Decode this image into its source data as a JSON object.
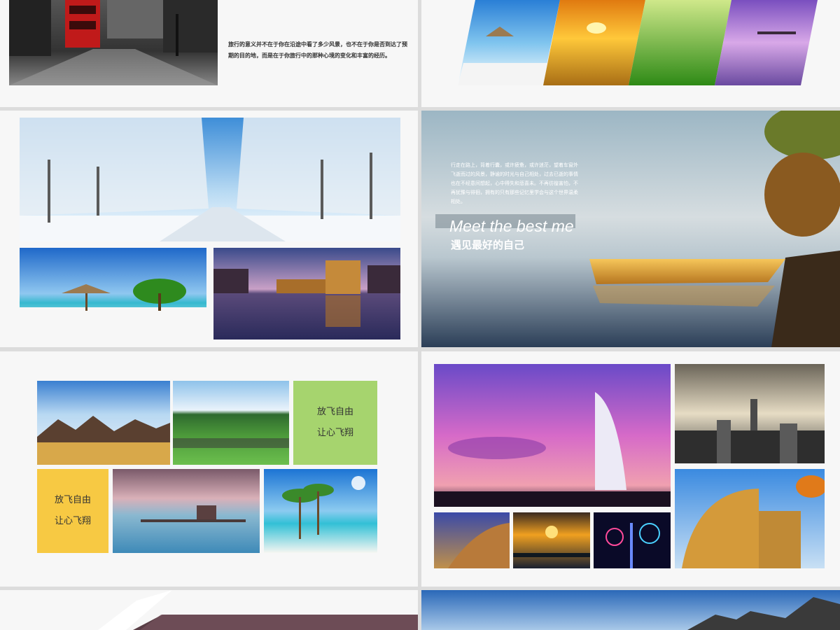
{
  "slides": {
    "travel_quote": {
      "text": "旅行的意义并不在于你在沿途中看了多少风景，也不在于你是否到达了预期的目的地，而是在于你旅行中的那种心境的变化和丰富的经历。"
    },
    "meet": {
      "paragraph": "行走在路上，背着行囊，或许疲惫，或许迷茫，望着车窗外飞逝而过的风景，静谧的时光与自己相处，过去已逝的事情也在不经意间想起，心中得失和悲喜未。不再彷徨害怕，不再犹豫与徘徊，拥有的只有那些记忆里学会与这个世界温柔相处。",
      "title_en": "Meet the best me",
      "title_cn": "遇见最好的自己"
    },
    "fly": {
      "tile_green_line1": "放飞自由",
      "tile_green_line2": "让心飞翔",
      "tile_yellow_line1": "放飞自由",
      "tile_yellow_line2": "让心飞翔"
    }
  },
  "colors": {
    "tile_green": "#a6d46e",
    "tile_yellow": "#f7c943"
  }
}
